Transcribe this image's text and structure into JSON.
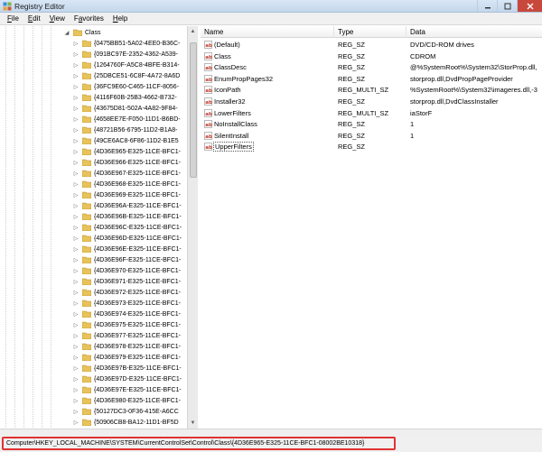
{
  "window": {
    "title": "Registry Editor"
  },
  "menu": [
    {
      "pre": "",
      "u": "F",
      "post": "ile"
    },
    {
      "pre": "",
      "u": "E",
      "post": "dit"
    },
    {
      "pre": "",
      "u": "V",
      "post": "iew"
    },
    {
      "pre": "F",
      "u": "a",
      "post": "vorites"
    },
    {
      "pre": "",
      "u": "H",
      "post": "elp"
    }
  ],
  "tree": {
    "parent": "Class",
    "keys": [
      "{0475BB51-5A02-4EE0-B36C-",
      "{091BC97E-2352-4362-A539-",
      "{1264760F-A5C8-4BFE-B314-",
      "{25DBCE51-6C8F-4A72-8A6D",
      "{36FC9E60-C465-11CF-8056-",
      "{4116F60B-25B3-4662-B732-",
      "{43675D81-502A-4A82-9F84-",
      "{4658EE7E-F050-11D1-B6BD-",
      "{48721B56-6795-11D2-B1A8-",
      "{49CE6AC8-6F86-11D2-B1E5",
      "{4D36E965-E325-11CE-BFC1-",
      "{4D36E966-E325-11CE-BFC1-",
      "{4D36E967-E325-11CE-BFC1-",
      "{4D36E968-E325-11CE-BFC1-",
      "{4D36E969-E325-11CE-BFC1-",
      "{4D36E96A-E325-11CE-BFC1-",
      "{4D36E96B-E325-11CE-BFC1-",
      "{4D36E96C-E325-11CE-BFC1-",
      "{4D36E96D-E325-11CE-BFC1-",
      "{4D36E96E-E325-11CE-BFC1-",
      "{4D36E96F-E325-11CE-BFC1-",
      "{4D36E970-E325-11CE-BFC1-",
      "{4D36E971-E325-11CE-BFC1-",
      "{4D36E972-E325-11CE-BFC1-",
      "{4D36E973-E325-11CE-BFC1-",
      "{4D36E974-E325-11CE-BFC1-",
      "{4D36E975-E325-11CE-BFC1-",
      "{4D36E977-E325-11CE-BFC1-",
      "{4D36E978-E325-11CE-BFC1-",
      "{4D36E979-E325-11CE-BFC1-",
      "{4D36E97B-E325-11CE-BFC1-",
      "{4D36E97D-E325-11CE-BFC1-",
      "{4D36E97E-E325-11CE-BFC1-",
      "{4D36E980-E325-11CE-BFC1-",
      "{50127DC3-0F36-415E-A6CC",
      "{50906CB8-BA12-11D1-BF5D"
    ]
  },
  "values": {
    "columns": [
      "Name",
      "Type",
      "Data"
    ],
    "rows": [
      {
        "name": "(Default)",
        "type": "REG_SZ",
        "data": "DVD/CD-ROM drives",
        "icon": "string-value-icon"
      },
      {
        "name": "Class",
        "type": "REG_SZ",
        "data": "CDROM",
        "icon": "string-value-icon"
      },
      {
        "name": "ClassDesc",
        "type": "REG_SZ",
        "data": "@%SystemRoot%\\System32\\StorProp.dll,",
        "icon": "string-value-icon"
      },
      {
        "name": "EnumPropPages32",
        "type": "REG_SZ",
        "data": "storprop.dll,DvdPropPageProvider",
        "icon": "string-value-icon"
      },
      {
        "name": "IconPath",
        "type": "REG_MULTI_SZ",
        "data": "%SystemRoot%\\System32\\imageres.dll,-3",
        "icon": "string-value-icon"
      },
      {
        "name": "Installer32",
        "type": "REG_SZ",
        "data": "storprop.dll,DvdClassInstaller",
        "icon": "string-value-icon"
      },
      {
        "name": "LowerFilters",
        "type": "REG_MULTI_SZ",
        "data": "iaStorF",
        "icon": "string-value-icon"
      },
      {
        "name": "NoInstallClass",
        "type": "REG_SZ",
        "data": "1",
        "icon": "string-value-icon"
      },
      {
        "name": "SilentInstall",
        "type": "REG_SZ",
        "data": "1",
        "icon": "string-value-icon"
      },
      {
        "name": "UpperFilters",
        "type": "REG_SZ",
        "data": "",
        "icon": "string-value-icon",
        "selected": true
      }
    ]
  },
  "status": {
    "path": "Computer\\HKEY_LOCAL_MACHINE\\SYSTEM\\CurrentControlSet\\Control\\Class\\{4D36E965-E325-11CE-BFC1-08002BE10318}"
  },
  "colors": {
    "highlight_border": "#e03232",
    "folder": "#e8c25a"
  }
}
